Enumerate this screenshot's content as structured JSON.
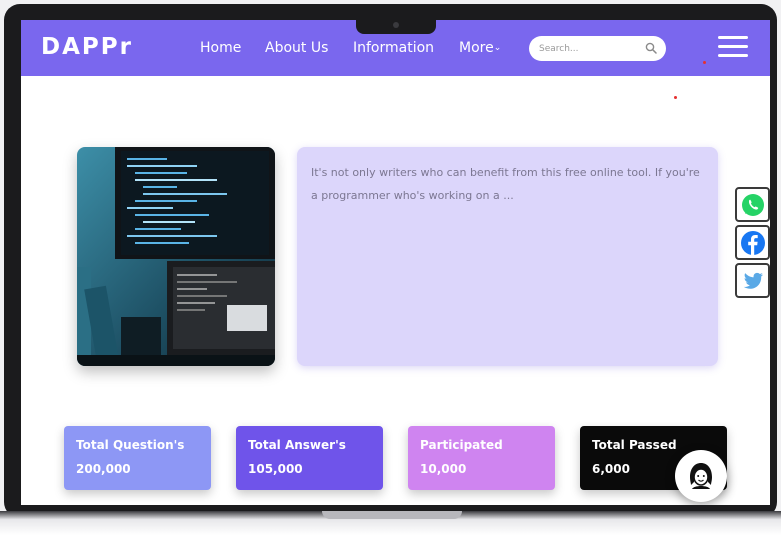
{
  "nav": {
    "logo": "DAPPr",
    "links": [
      {
        "label": "Home"
      },
      {
        "label": "About Us"
      },
      {
        "label": "Information"
      },
      {
        "label": "More"
      }
    ],
    "search_placeholder": "Search...",
    "hamburger_icon": "hamburger-menu-icon",
    "search_icon": "magnifier-icon"
  },
  "hero": {
    "image": "code-editor-monitor-photo",
    "text": "It's not only writers who can benefit from this free online tool. If you're a programmer who's working on a ..."
  },
  "stats": [
    {
      "label": "Total Question's",
      "value": "200,000",
      "color": "#8d97f5"
    },
    {
      "label": "Total Answer's",
      "value": "105,000",
      "color": "#6f54ea"
    },
    {
      "label": "Participated",
      "value": "10,000",
      "color": "#cf84f0"
    },
    {
      "label": "Total Passed",
      "value": "6,000",
      "color": "#0a0a0a"
    }
  ],
  "social": [
    {
      "name": "whatsapp-icon",
      "color": "#25d366"
    },
    {
      "name": "facebook-icon",
      "color": "#1877f2"
    },
    {
      "name": "twitter-icon",
      "color": "#5aa9e6"
    }
  ],
  "chat": {
    "icon": "support-agent-icon"
  },
  "colors": {
    "accent": "#7a67ee",
    "info_bg": "#dcd6fb"
  }
}
